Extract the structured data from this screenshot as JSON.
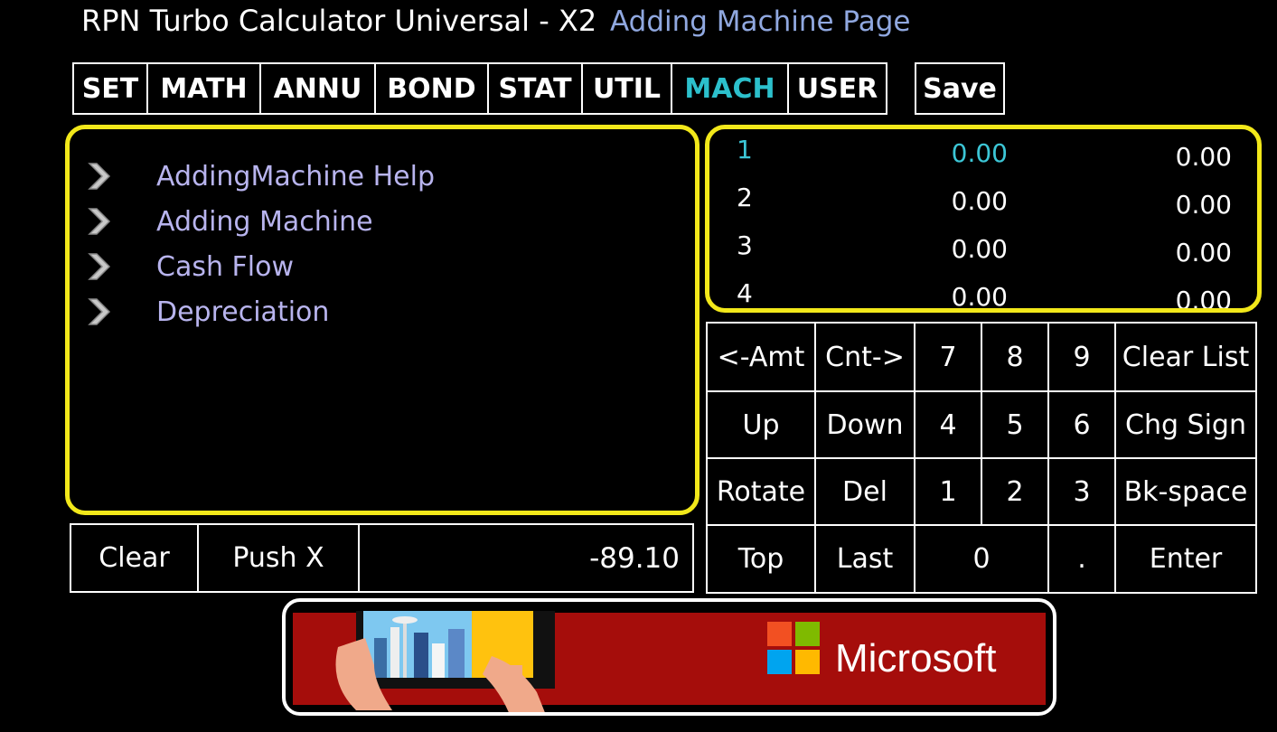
{
  "header": {
    "app_title": "RPN Turbo Calculator Universal - X2",
    "page_title": "Adding Machine Page"
  },
  "tabs": [
    {
      "label": "SET",
      "active": false
    },
    {
      "label": "MATH",
      "active": false
    },
    {
      "label": "ANNU",
      "active": false
    },
    {
      "label": "BOND",
      "active": false
    },
    {
      "label": "STAT",
      "active": false
    },
    {
      "label": "UTIL",
      "active": false
    },
    {
      "label": "MACH",
      "active": true
    },
    {
      "label": "USER",
      "active": false
    }
  ],
  "save_label": "Save",
  "menu": {
    "items": [
      {
        "label": "AddingMachine Help",
        "icon": "chevron-right-icon"
      },
      {
        "label": "Adding Machine",
        "icon": "chevron-right-icon"
      },
      {
        "label": "Cash Flow",
        "icon": "chevron-right-icon"
      },
      {
        "label": "Depreciation",
        "icon": "chevron-right-icon"
      }
    ]
  },
  "stack": {
    "rows": [
      {
        "index": "1",
        "amount": "0.00",
        "count": "0.00",
        "current": true
      },
      {
        "index": "2",
        "amount": "0.00",
        "count": "0.00",
        "current": false
      },
      {
        "index": "3",
        "amount": "0.00",
        "count": "0.00",
        "current": false
      },
      {
        "index": "4",
        "amount": "0.00",
        "count": "0.00",
        "current": false
      }
    ]
  },
  "bottom_bar": {
    "clear_label": "Clear",
    "push_label": "Push X",
    "display_value": "-89.10"
  },
  "keypad": {
    "rows": [
      [
        "<-Amt",
        "Cnt->",
        "7",
        "8",
        "9",
        "Clear List"
      ],
      [
        "Up",
        "Down",
        "4",
        "5",
        "6",
        "Chg Sign"
      ],
      [
        "Rotate",
        "Del",
        "1",
        "2",
        "3",
        "Bk-space"
      ],
      [
        "Top",
        "Last",
        "0",
        ".",
        "Enter"
      ]
    ]
  },
  "ad": {
    "brand": "Microsoft"
  },
  "colors": {
    "background": "#000000",
    "panel_border": "#f2e81a",
    "active_tab": "#2cc0cc",
    "menu_text": "#b8b4ee",
    "page_title": "#90a8e0",
    "ad_red": "#a50d0b"
  }
}
